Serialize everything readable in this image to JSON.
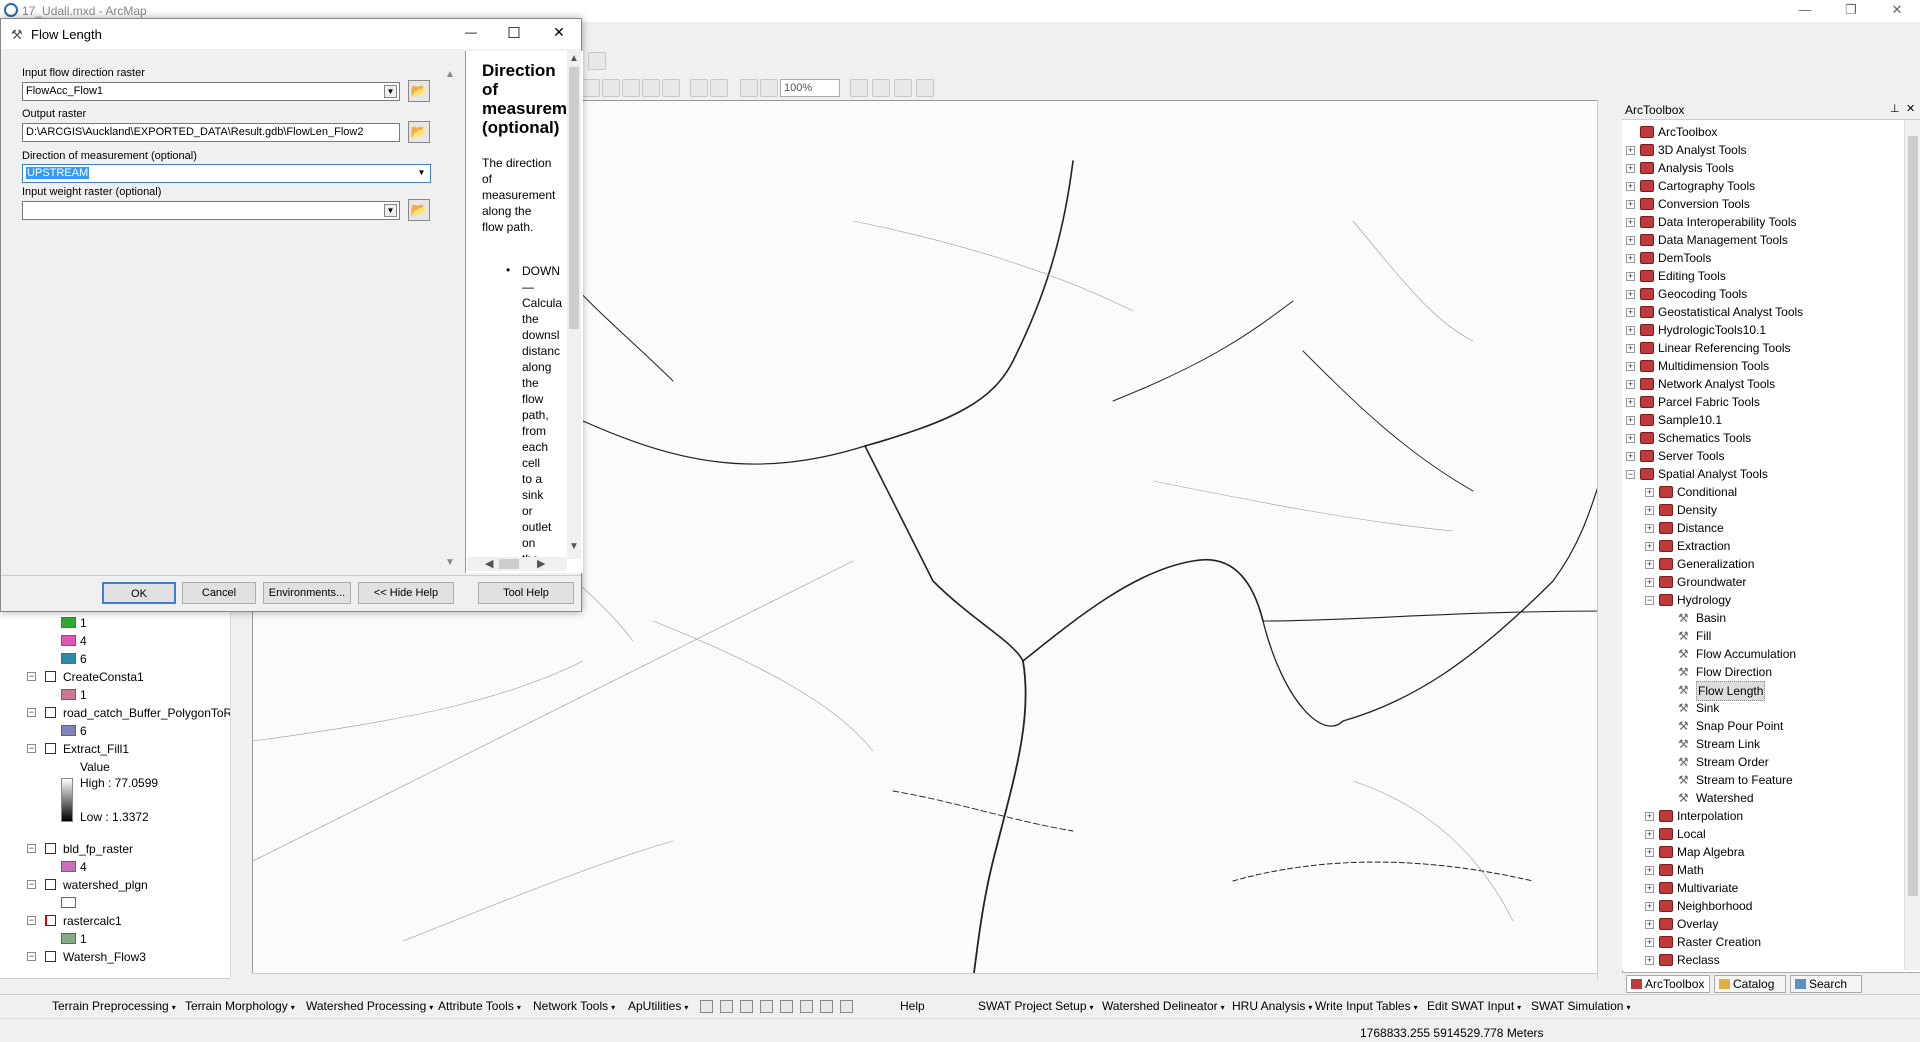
{
  "app": {
    "title": "17_Udall.mxd - ArcMap"
  },
  "window_controls": {
    "minimize": "—",
    "restore": "❐",
    "close": "✕"
  },
  "toolbar": {
    "zoom_value": "100%"
  },
  "dialog": {
    "title": "Flow Length",
    "controls": {
      "minimize": "—",
      "maximize": "☐",
      "close": "✕"
    },
    "fields": {
      "input_flow_label": "Input flow direction raster",
      "input_flow_value": "FlowAcc_Flow1",
      "output_label": "Output raster",
      "output_value": "D:\\ARCGIS\\Auckland\\EXPORTED_DATA\\Result.gdb\\FlowLen_Flow2",
      "direction_label": "Direction of measurement (optional)",
      "direction_value": "UPSTREAM",
      "weight_label": "Input weight raster (optional)",
      "weight_value": ""
    },
    "buttons": {
      "ok": "OK",
      "cancel": "Cancel",
      "environments": "Environments...",
      "hide_help": "<< Hide Help",
      "tool_help": "Tool Help"
    },
    "help": {
      "heading_lines": [
        "Direction",
        "of",
        "measureme",
        "(optional)"
      ],
      "body_lines": [
        "The direction",
        "of",
        "measurement",
        "along the",
        "flow path."
      ],
      "bullet_label": "DOWN",
      "bullet_dash": "—",
      "bullet_lines": [
        "Calcula",
        "the",
        "downsl",
        "distanc",
        "along",
        "the",
        "flow",
        "path,",
        "from",
        "each",
        "cell",
        "to a",
        "sink",
        "or",
        "outlet",
        "on",
        "the"
      ]
    }
  },
  "toc": {
    "rows": [
      {
        "type": "swatch",
        "color": "#2ea82e",
        "label": "1"
      },
      {
        "type": "swatch",
        "color": "#e055b6",
        "label": "4"
      },
      {
        "type": "swatch",
        "color": "#2c8aa6",
        "label": "6"
      },
      {
        "type": "layer",
        "label": "CreateConsta1"
      },
      {
        "type": "swatch",
        "color": "#c97b8d",
        "label": "1"
      },
      {
        "type": "layer",
        "label": "road_catch_Buffer_PolygonToR"
      },
      {
        "type": "swatch",
        "color": "#7e85b8",
        "label": "6"
      },
      {
        "type": "layer",
        "label": "Extract_Fill1"
      },
      {
        "type": "text",
        "label": "Value"
      },
      {
        "type": "gradient-high",
        "label": "High : 77.0599"
      },
      {
        "type": "gradient-low",
        "label": "Low : 1.3372"
      },
      {
        "type": "layer",
        "label": "bld_fp_raster"
      },
      {
        "type": "swatch",
        "color": "#c76fb8",
        "label": "4"
      },
      {
        "type": "layer",
        "label": "watershed_plgn"
      },
      {
        "type": "swatch-empty",
        "color": "#ffffff",
        "label": ""
      },
      {
        "type": "layer-red",
        "label": "rastercalc1"
      },
      {
        "type": "swatch",
        "color": "#86a986",
        "label": "1"
      },
      {
        "type": "layer",
        "label": "Watersh_Flow3"
      }
    ]
  },
  "arctoolbox": {
    "title": "ArcToolbox",
    "root": "ArcToolbox",
    "toolboxes": [
      "3D Analyst Tools",
      "Analysis Tools",
      "Cartography Tools",
      "Conversion Tools",
      "Data Interoperability Tools",
      "Data Management Tools",
      "DemTools",
      "Editing Tools",
      "Geocoding Tools",
      "Geostatistical Analyst Tools",
      "HydrologicTools10.1",
      "Linear Referencing Tools",
      "Multidimension Tools",
      "Network Analyst Tools",
      "Parcel Fabric Tools",
      "Sample10.1",
      "Schematics Tools",
      "Server Tools"
    ],
    "spatial_analyst": "Spatial Analyst Tools",
    "sa_before": [
      "Conditional",
      "Density",
      "Distance",
      "Extraction",
      "Generalization",
      "Groundwater"
    ],
    "hydrology": "Hydrology",
    "hydrology_tools": [
      "Basin",
      "Fill",
      "Flow Accumulation",
      "Flow Direction",
      "Flow Length",
      "Sink",
      "Snap Pour Point",
      "Stream Link",
      "Stream Order",
      "Stream to Feature",
      "Watershed"
    ],
    "sa_after": [
      "Interpolation",
      "Local",
      "Map Algebra",
      "Math",
      "Multivariate",
      "Neighborhood",
      "Overlay",
      "Raster Creation",
      "Reclass"
    ],
    "tabs": [
      "ArcToolbox",
      "Catalog",
      "Search"
    ]
  },
  "bottom_toolbar": {
    "left_menus": [
      "Terrain Preprocessing",
      "Terrain Morphology",
      "Watershed Processing",
      "Attribute Tools",
      "Network Tools",
      "ApUtilities"
    ],
    "help": "Help",
    "right_menus": [
      "SWAT Project Setup",
      "Watershed Delineator",
      "HRU Analysis",
      "Write Input Tables",
      "Edit SWAT Input",
      "SWAT Simulation"
    ]
  },
  "status": {
    "coordinates": "1768833.255  5914529.778 Meters"
  }
}
